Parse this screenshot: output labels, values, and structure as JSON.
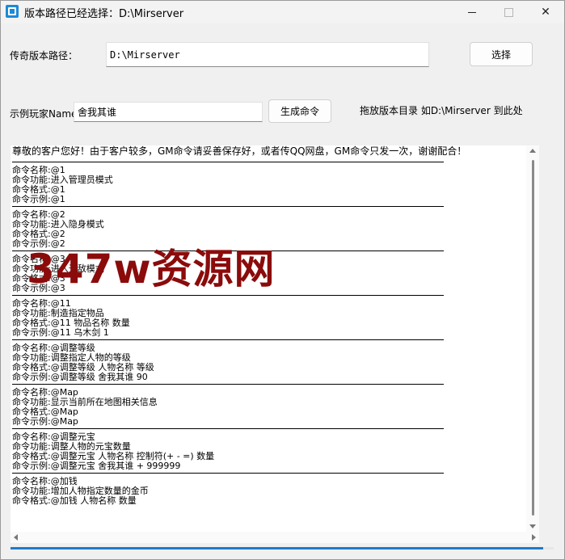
{
  "window": {
    "title": "版本路径已经选择：D:\\Mirserver",
    "controls": {
      "minimize_icon": "minimize-icon",
      "maximize_icon": "maximize-icon",
      "close_icon": "close-icon",
      "close_glyph": "✕"
    }
  },
  "form": {
    "path_label": "传奇版本路径：",
    "path_value": "D:\\Mirserver",
    "select_button": "选择",
    "player_label": "示例玩家Name:",
    "player_value": "舍我其谁",
    "generate_button": "生成命令",
    "drop_hint": "拖放版本目录 如D:\\Mirserver 到此处"
  },
  "log": {
    "notice": "尊敬的客户您好！由于客户较多，GM命令请妥善保存好，或者传QQ网盘，GM命令只发一次，谢谢配合！",
    "entries": [
      {
        "lines": [
          "命令名称:@1",
          "命令功能:进入管理员模式",
          "命令格式:@1",
          "命令示例:@1"
        ]
      },
      {
        "lines": [
          "命令名称:@2",
          "命令功能:进入隐身模式",
          "命令格式:@2",
          "命令示例:@2"
        ]
      },
      {
        "lines": [
          "命令名称:@3",
          "命令功能:进入无敌模式",
          "命令格式:@3",
          "命令示例:@3"
        ]
      },
      {
        "lines": [
          "命令名称:@11",
          "命令功能:制造指定物品",
          "命令格式:@11 物品名称 数量",
          "命令示例:@11 乌木剑 1"
        ]
      },
      {
        "lines": [
          "命令名称:@调整等级",
          "命令功能:调整指定人物的等级",
          "命令格式:@调整等级 人物名称 等级",
          "命令示例:@调整等级 舍我其谁 90"
        ]
      },
      {
        "lines": [
          "命令名称:@Map",
          "命令功能:显示当前所在地图相关信息",
          "命令格式:@Map",
          "命令示例:@Map"
        ]
      },
      {
        "lines": [
          "命令名称:@调整元宝",
          "命令功能:调整人物的元宝数量",
          "命令格式:@调整元宝 人物名称 控制符(+ - =) 数量",
          "命令示例:@调整元宝 舍我其谁 + 999999"
        ]
      },
      {
        "lines": [
          "命令名称:@加钱",
          "命令功能:增加人物指定数量的金币",
          "命令格式:@加钱 人物名称 数量"
        ]
      }
    ]
  },
  "progress": {
    "value": 0.98,
    "color": "#1f7bc9"
  },
  "watermark": "347w资源网"
}
